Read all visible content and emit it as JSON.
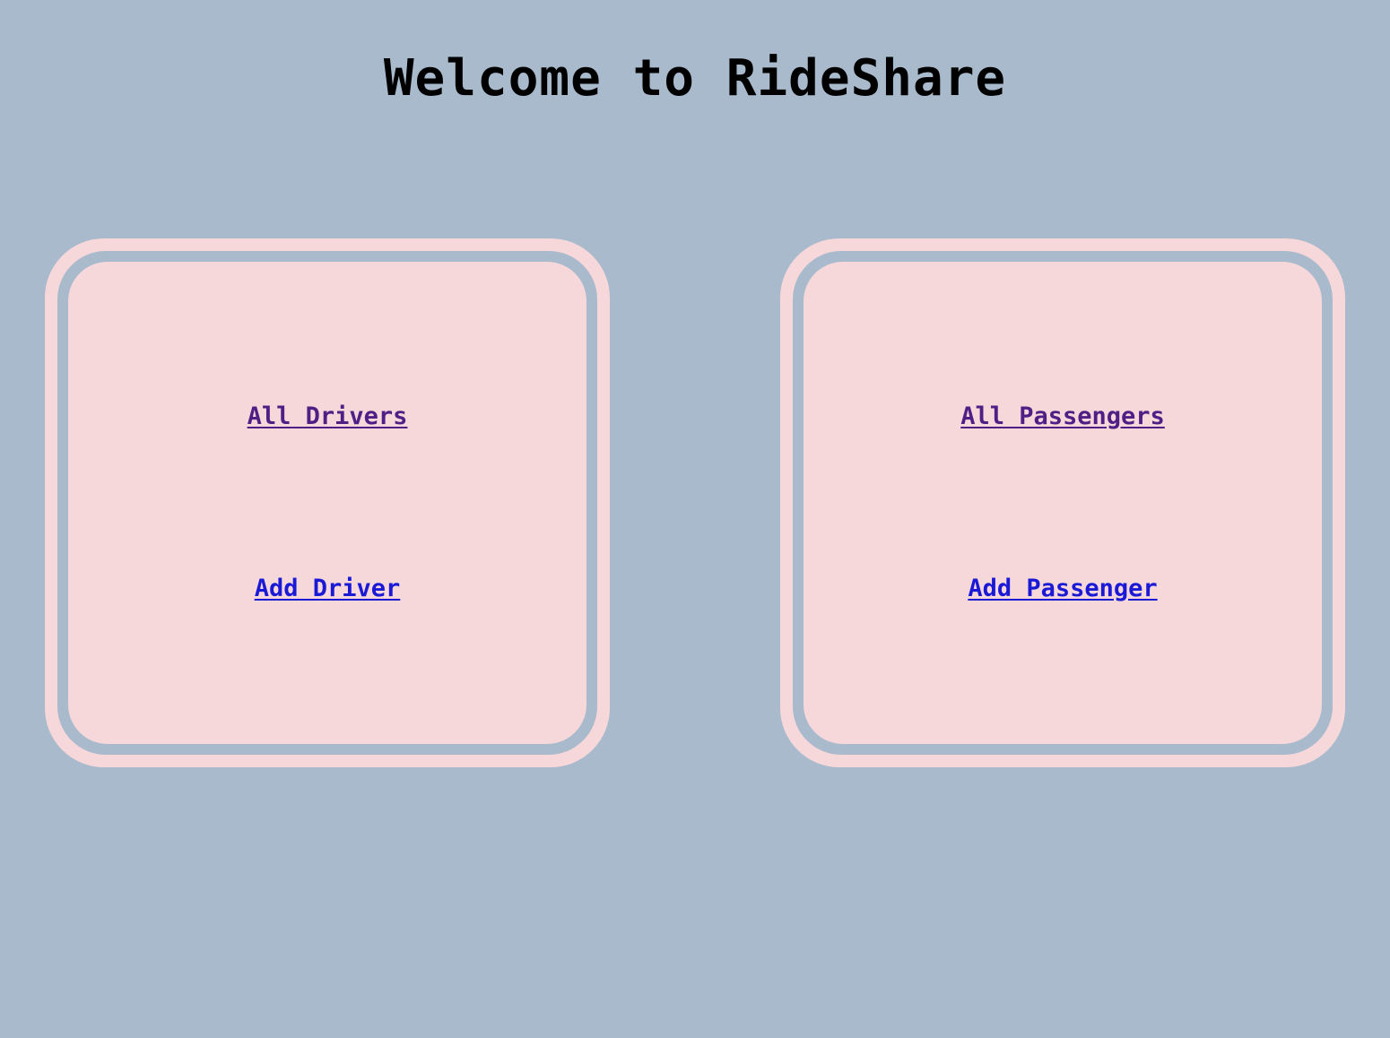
{
  "header": {
    "title": "Welcome to RideShare"
  },
  "panels": [
    {
      "id": "drivers",
      "links": {
        "all_label": "All Drivers",
        "add_label": "Add Driver"
      }
    },
    {
      "id": "passengers",
      "links": {
        "all_label": "All Passengers",
        "add_label": "Add Passenger"
      }
    }
  ],
  "colors": {
    "background": "#a9bacc",
    "panel": "#f6d8db",
    "visited_link": "#4f1f86",
    "link": "#1a1ad6",
    "title": "#000000"
  }
}
